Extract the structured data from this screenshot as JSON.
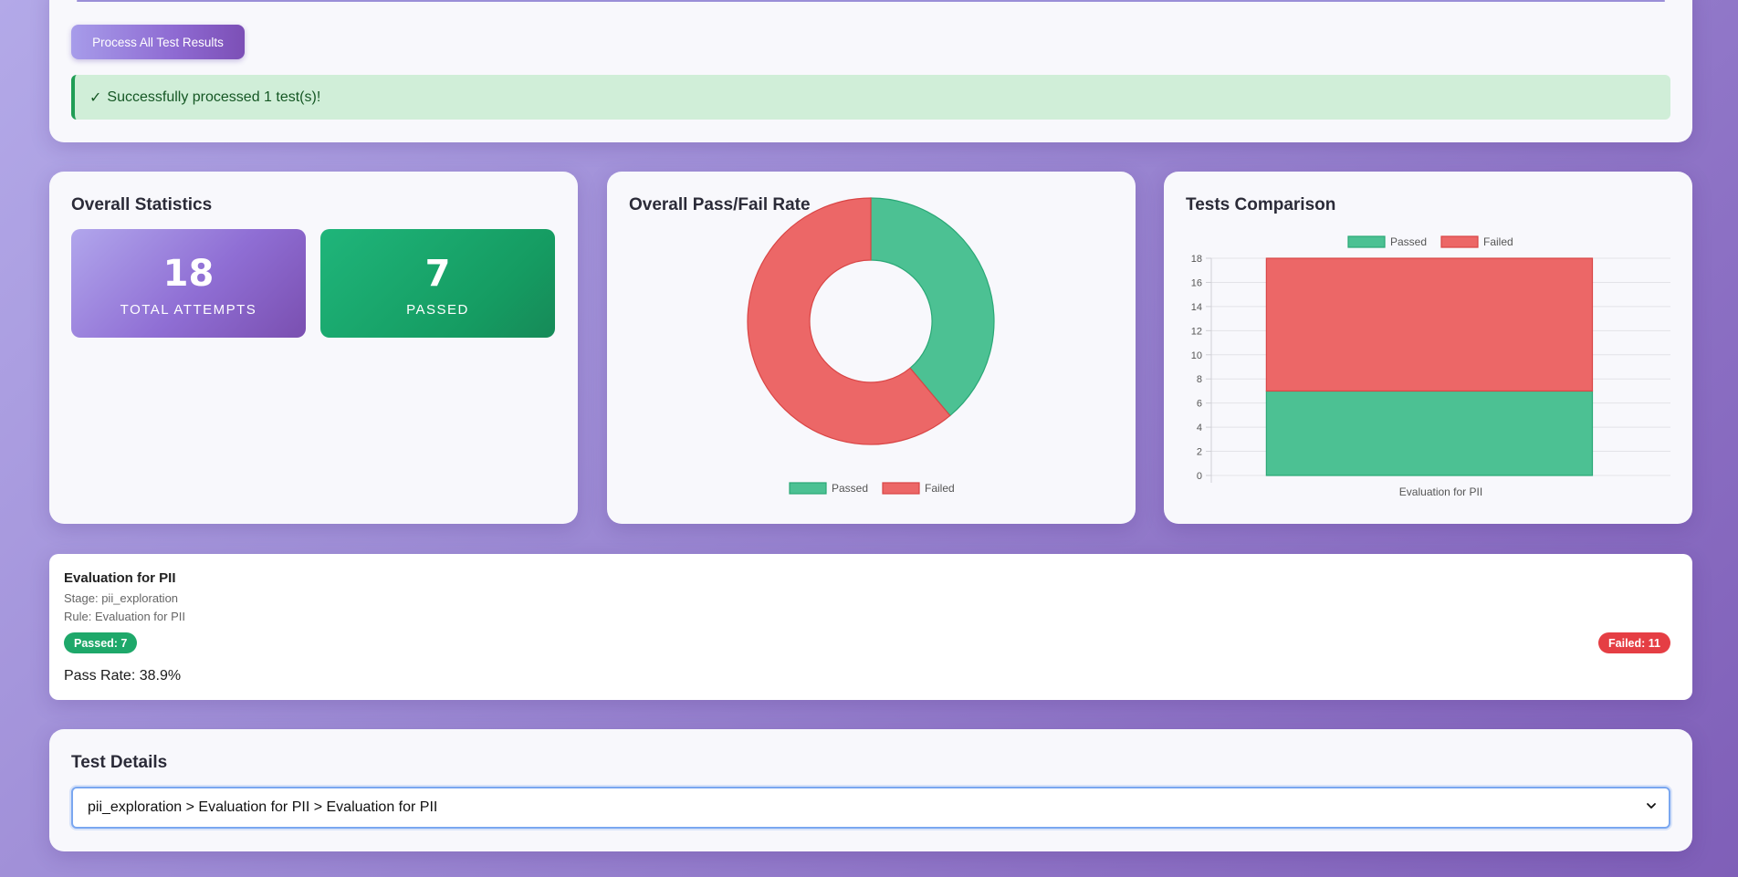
{
  "top": {
    "process_button_label": "Process All Test Results",
    "success_check": "✓",
    "success_message": "Successfully processed 1 test(s)!"
  },
  "stats": {
    "title": "Overall Statistics",
    "total_value": "18",
    "total_label": "TOTAL ATTEMPTS",
    "passed_value": "7",
    "passed_label": "PASSED"
  },
  "pie": {
    "title": "Overall Pass/Fail Rate"
  },
  "bar": {
    "title": "Tests Comparison"
  },
  "colors": {
    "passed": "#4cc193",
    "passed_border": "#2aa876",
    "failed": "#ec6767",
    "failed_border": "#d94545"
  },
  "chart_data": [
    {
      "type": "pie",
      "labels": [
        "Passed",
        "Failed"
      ],
      "values": [
        7,
        11
      ],
      "legend": "bottom",
      "donut": true
    },
    {
      "type": "bar",
      "stacked": true,
      "categories": [
        "Evaluation for PII"
      ],
      "series": [
        {
          "name": "Passed",
          "values": [
            7
          ]
        },
        {
          "name": "Failed",
          "values": [
            11
          ]
        }
      ],
      "ylim": [
        0,
        18
      ],
      "yticks": [
        0,
        2,
        4,
        6,
        8,
        10,
        12,
        14,
        16,
        18
      ],
      "legend": "top",
      "grid": true
    }
  ],
  "detail": {
    "title": "Evaluation for PII",
    "stage": "Stage: pii_exploration",
    "rule": "Rule: Evaluation for PII",
    "passed_badge": "Passed: 7",
    "failed_badge": "Failed: 11",
    "pass_rate": "Pass Rate: 38.9%"
  },
  "test_details": {
    "title": "Test Details",
    "selected": "pii_exploration > Evaluation for PII > Evaluation for PII"
  }
}
